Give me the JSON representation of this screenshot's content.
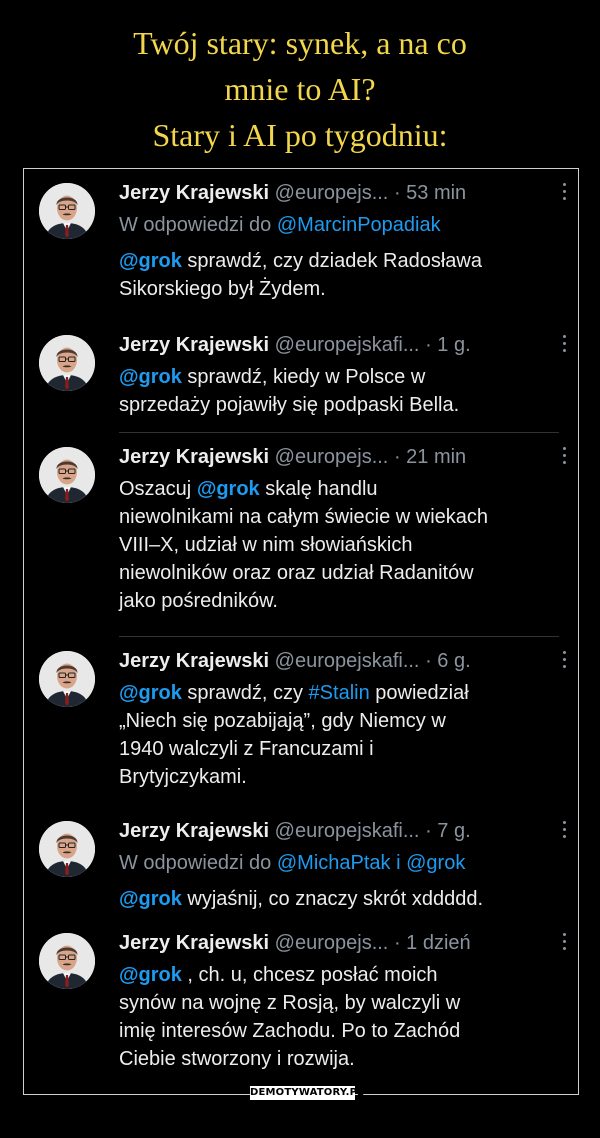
{
  "meme": {
    "title_line1": "Twój stary: synek, a na co",
    "title_line2": "mnie to AI?",
    "title_line3": "Stary i AI po tygodniu:",
    "watermark": "DEMOTYWATORY.PL"
  },
  "colors": {
    "title": "#f2d64b",
    "mention": "#1d9bf0",
    "muted": "#8b949e",
    "text": "#ededed"
  },
  "tweets": [
    {
      "name": "Jerzy Krajewski",
      "handle": "@europejs...",
      "time": "· 53 min",
      "reply_prefix": "W odpowiedzi do",
      "reply_to": "@MarcinPopadiak",
      "lines": [
        {
          "mention": "@grok",
          "text": " sprawdź, czy dziadek Radosława"
        },
        {
          "text": "Sikorskiego był Żydem."
        }
      ]
    },
    {
      "name": "Jerzy Krajewski",
      "handle": "@europejskafi...",
      "time": "· 1 g.",
      "lines": [
        {
          "mention": "@grok",
          "text": " sprawdź, kiedy w Polsce w"
        },
        {
          "text": "sprzedaży pojawiły się podpaski Bella."
        }
      ]
    },
    {
      "name": "Jerzy Krajewski",
      "handle": "@europejs...",
      "time": "· 21 min",
      "lines": [
        {
          "pre": "Oszacuj ",
          "mention": "@grok",
          "text": " skalę handlu"
        },
        {
          "text": "niewolnikami na całym świecie w wiekach"
        },
        {
          "text": "VIII–X, udział w nim słowiańskich"
        },
        {
          "text": "niewolników oraz oraz udział Radanitów"
        },
        {
          "text": "jako pośredników."
        }
      ]
    },
    {
      "name": "Jerzy Krajewski",
      "handle": "@europejskafi...",
      "time": "· 6 g.",
      "lines": [
        {
          "mention": "@grok",
          "text": " sprawdź, czy ",
          "mention2": "#Stalin",
          "text2": " powiedział"
        },
        {
          "text": "„Niech się pozabijają”, gdy Niemcy w"
        },
        {
          "text": "1940 walczyli z Francuzami i"
        },
        {
          "text": "Brytyjczykami."
        }
      ]
    },
    {
      "name": "Jerzy Krajewski",
      "handle": "@europejskafi...",
      "time": "· 7 g.",
      "reply_prefix": "W odpowiedzi do",
      "reply_to": "@MichaPtak i @grok",
      "lines": [
        {
          "mention": "@grok",
          "text": " wyjaśnij, co znaczy skrót xddddd."
        }
      ]
    },
    {
      "name": "Jerzy Krajewski",
      "handle": "@europejs...",
      "time": "· 1 dzień",
      "lines": [
        {
          "mention": "@grok",
          "text": " , ch.  u, chcesz posłać moich"
        },
        {
          "text": "synów na wojnę z Rosją, by walczyli w"
        },
        {
          "text": "imię interesów Zachodu. Po to Zachód"
        },
        {
          "text": "Ciebie stworzony i rozwija."
        }
      ]
    }
  ]
}
